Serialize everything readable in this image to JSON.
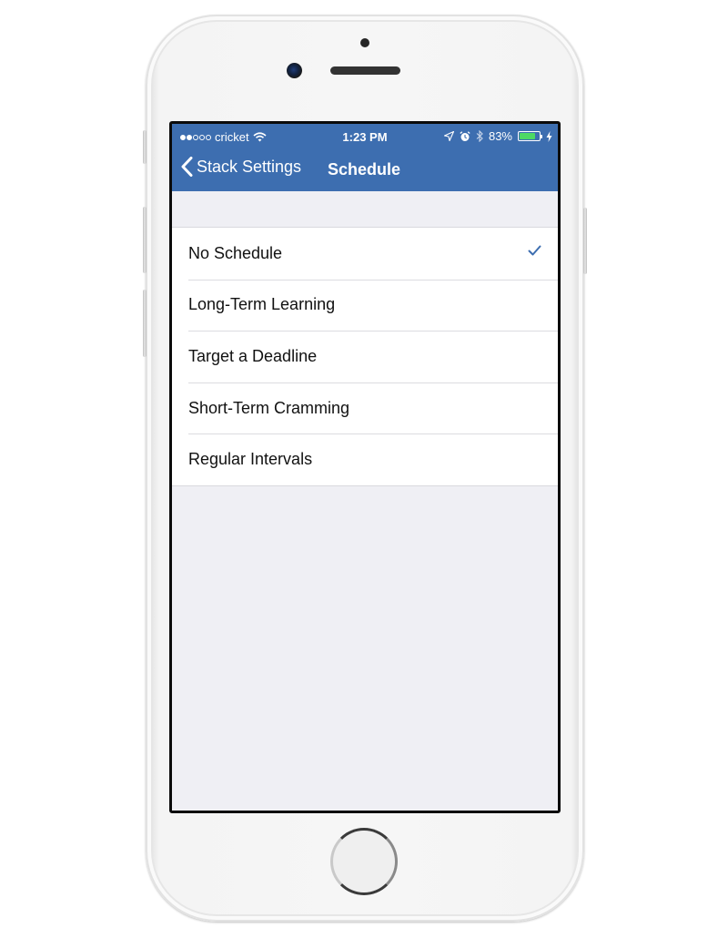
{
  "status_bar": {
    "carrier": "cricket",
    "signal_strength": 2,
    "signal_max": 5,
    "time": "1:23 PM",
    "battery_percent_label": "83%",
    "battery_level": 0.83,
    "icons": [
      "location-icon",
      "alarm-icon",
      "bluetooth-icon",
      "battery-icon",
      "charging-icon"
    ]
  },
  "nav_bar": {
    "back_label": "Stack Settings",
    "title": "Schedule"
  },
  "schedule_options": [
    {
      "label": "No Schedule",
      "selected": true
    },
    {
      "label": "Long-Term Learning",
      "selected": false
    },
    {
      "label": "Target a Deadline",
      "selected": false
    },
    {
      "label": "Short-Term Cramming",
      "selected": false
    },
    {
      "label": "Regular Intervals",
      "selected": false
    }
  ],
  "colors": {
    "nav_bar": "#3d6eb0",
    "checkmark": "#3d6eb0",
    "background": "#efeff4",
    "battery_fill": "#4cd964"
  }
}
